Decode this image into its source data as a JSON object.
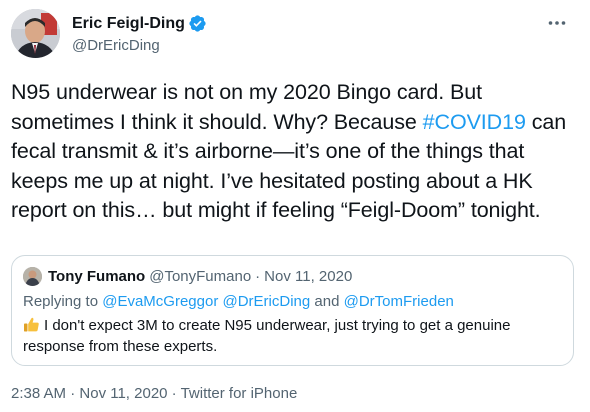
{
  "tweet": {
    "author": {
      "name": "Eric Feigl-Ding",
      "handle": "@DrEricDing",
      "verified": true,
      "verified_icon": "verified-badge-icon"
    },
    "more_icon": "more-horizontal-icon",
    "text": {
      "part1": "N95 underwear is not on my 2020 Bingo card. But sometimes I think it should. Why? Because ",
      "hashtag": "#COVID19",
      "part2": " can fecal transmit & it’s airborne—it’s one of the things that keeps me up at night. I’ve hesitated posting about a HK report on this… but might if feeling “Feigl-Doom” tonight."
    },
    "quoted": {
      "name": "Tony Fumano",
      "handle": "@TonyFumano",
      "separator": "·",
      "date": "Nov 11, 2020",
      "reply_prefix": "Replying to ",
      "reply_mentions": [
        "@EvaMcGreggor",
        "@DrEricDing",
        "@DrTomFrieden"
      ],
      "reply_and": " and ",
      "emoji_icon": "thumbs-up-icon",
      "text": "I don't expect 3M to create N95 underwear, just trying to get a genuine response from these experts."
    },
    "footer": {
      "time": "2:38 AM",
      "separator": " · ",
      "date": "Nov 11, 2020",
      "source": "Twitter for iPhone"
    }
  },
  "colors": {
    "link": "#1d9bf0",
    "text": "#0f1419",
    "secondary": "#536471",
    "border": "#cfd9de",
    "verified": "#1d9bf0",
    "thumb": "#f7c03d"
  }
}
